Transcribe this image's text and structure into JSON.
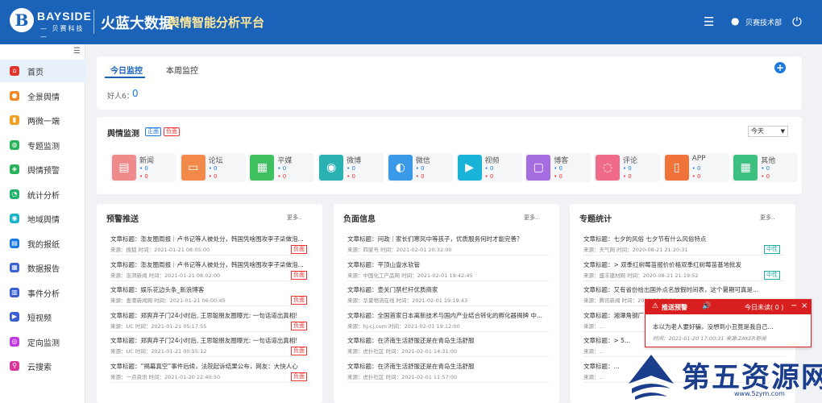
{
  "header": {
    "logo_mark": "B",
    "logo_text": "BAYSIDE",
    "logo_sub": "— 贝赛科技 —",
    "brand_title": "火蓝大数据",
    "brand_subtitle": "舆情智能分析平台",
    "user": "贝赛技术部"
  },
  "sidebar": {
    "items": [
      {
        "label": "首页",
        "icon": "home-icon",
        "color": "#e0362c"
      },
      {
        "label": "全景舆情",
        "icon": "location-icon",
        "color": "#f08a24"
      },
      {
        "label": "两微一端",
        "icon": "phone-icon",
        "color": "#f0a020"
      },
      {
        "label": "专题监测",
        "icon": "globe-icon",
        "color": "#2ab25a"
      },
      {
        "label": "舆情预警",
        "icon": "alarm-icon",
        "color": "#2ab25a"
      },
      {
        "label": "统计分析",
        "icon": "pie-icon",
        "color": "#23b26d"
      },
      {
        "label": "地域舆情",
        "icon": "map-pin-icon",
        "color": "#1ab3c8"
      },
      {
        "label": "我的报纸",
        "icon": "newspaper-icon",
        "color": "#1a7ae0"
      },
      {
        "label": "数据报告",
        "icon": "report-icon",
        "color": "#3a5fd0"
      },
      {
        "label": "事件分析",
        "icon": "chart-icon",
        "color": "#3a5fd0"
      },
      {
        "label": "短视频",
        "icon": "video-icon",
        "color": "#3a5fd0"
      },
      {
        "label": "定向监测",
        "icon": "target-icon",
        "color": "#c03adf"
      },
      {
        "label": "云搜索",
        "icon": "search-icon",
        "color": "#d8369a"
      }
    ]
  },
  "monitor": {
    "tabs": [
      "今日监控",
      "本周监控"
    ],
    "friend_label": "好人6：",
    "friend_value": "0"
  },
  "opinion": {
    "title": "舆情监测",
    "badge_pos": "正面",
    "badge_neg": "负面",
    "range": "今天",
    "sources": [
      {
        "name": "新闻",
        "icon": "news-icon",
        "color": "#f08b8b",
        "a": "• 0",
        "b": "• 0"
      },
      {
        "name": "论坛",
        "icon": "forum-icon",
        "color": "#f0894a",
        "a": "• 0",
        "b": "• 0"
      },
      {
        "name": "平媒",
        "icon": "print-icon",
        "color": "#3ec060",
        "a": "• 0",
        "b": "• 0"
      },
      {
        "name": "微博",
        "icon": "weibo-icon",
        "color": "#2ab2b2",
        "a": "• 0",
        "b": "• 0"
      },
      {
        "name": "微信",
        "icon": "wechat-icon",
        "color": "#3a9ae8",
        "a": "• 0",
        "b": "• 0"
      },
      {
        "name": "视频",
        "icon": "video-play-icon",
        "color": "#1ab3d8",
        "a": "• 0",
        "b": "• 0"
      },
      {
        "name": "博客",
        "icon": "blog-icon",
        "color": "#a66de0",
        "a": "• 0",
        "b": "• 0"
      },
      {
        "name": "评论",
        "icon": "comment-icon",
        "color": "#f06a8a",
        "a": "• 0",
        "b": "• 0"
      },
      {
        "name": "APP",
        "icon": "app-icon",
        "color": "#f0733a",
        "a": "• 0",
        "b": "• 0"
      },
      {
        "name": "其他",
        "icon": "grid-icon",
        "color": "#3ec080",
        "a": "• 0",
        "b": "• 0"
      }
    ]
  },
  "panels": [
    {
      "title": "预警推送",
      "more": "更多..",
      "items": [
        {
          "t": "文章标题：澎友圈周报｜卢书记等人被处分，韩国凭啥围攻李子柒做泡...",
          "m": "来源：搜狐    时间：2021-01-21 08:05:00",
          "tag": "负面"
        },
        {
          "t": "文章标题：澎友圈周报｜卢书记等人被处分，韩国凭啥围攻李子柒做泡...",
          "m": "来源：澎湃新闻    时间：2021-01-21 08:02:00",
          "tag": "负面"
        },
        {
          "t": "文章标题：娱乐花边头条_新浪博客",
          "m": "来源：查港新闻网    时间：2021-01-21 06:00:45",
          "tag": "负面"
        },
        {
          "t": "文章标题：郑爽弃子门24小时后, 王思聪朋友圈曝光: 一句话道出真相!",
          "m": "来源：UC    时间：2021-01-21 05:17:55",
          "tag": "负面"
        },
        {
          "t": "文章标题：郑爽弃子门24小时后, 王思聪朋友圈曝光: 一句话道出真相!",
          "m": "来源：UC    时间：2021-01-21 00:55:12",
          "tag": "负面"
        },
        {
          "t": "文章标题：“揭幕真空”事件后续，法院起诉结果公布，网友：大快人心",
          "m": "来源：一点资讯    时间：2021-01-20 22:40:50",
          "tag": "负面"
        }
      ]
    },
    {
      "title": "负面信息",
      "more": "更多..",
      "items": [
        {
          "t": "文章标题：问政｜家长们寒风中等孩子，优质服务何时才能完善？",
          "m": "来源：四家号    时间：2021-02-01 20:32:00",
          "tag": ""
        },
        {
          "t": "文章标题：平顶山壹水软管",
          "m": "来源：中国化工产品网    时间：2021-02-01 19:42:45",
          "tag": ""
        },
        {
          "t": "文章标题：壶关门禁栏杆优质商家",
          "m": "来源：华夏物流在线    时间：2021-02-01 19:19:43",
          "tag": ""
        },
        {
          "t": "文章标题：全国首家日本离新技术与国内产业结合转化的孵化器揭牌 中...",
          "m": "来源：hj-cj.com    时间：2021-02-01 19:12:00",
          "tag": ""
        },
        {
          "t": "文章标题：在济南生活舒服还是在青岛生活舒服",
          "m": "来源：虎扑社区    时间：2021-02-01 14:31:00",
          "tag": ""
        },
        {
          "t": "文章标题：在济南生活舒服还是在青岛生活舒服",
          "m": "来源：虎扑社区    时间：2021-02-01 11:57:00",
          "tag": ""
        }
      ]
    },
    {
      "title": "专题统计",
      "more": "更多..",
      "items": [
        {
          "t": "文章标题：七夕的风俗 七夕节有什么风俗特点",
          "m": "来源：天气网    时间：2020-08-21 21:20:31",
          "tag": "中性"
        },
        {
          "t": "文章标题：> 双季红树莓苗报价价格双季红树莓苗基地批发",
          "m": "来源：盛丰建材网    时间：2020-08-21 21:19:52",
          "tag": "中性"
        },
        {
          "t": "文章标题：又有省份给出国外点名放假时间表，这个暑期可真是...",
          "m": "来源：腾讯新闻    时间：2020-08-21 21:...",
          "tag": ""
        },
        {
          "t": "文章标题：湘潭角钢厂...",
          "m": "来源：...",
          "tag": ""
        },
        {
          "t": "文章标题：> 5...",
          "m": "来源：...",
          "tag": ""
        },
        {
          "t": "文章标题：...",
          "m": "来源：...",
          "tag": ""
        }
      ]
    }
  ],
  "alert": {
    "left": "推送预警",
    "right": "今日未读( 0 )",
    "body": "本以为老人要好骗，没想到小丑竟是我自己...",
    "meta": "时间：2021-01-20 17:00:31 来源:ZAKER新闻"
  },
  "watermark": {
    "text": "第五资源网",
    "url": "www.5zym.com"
  }
}
